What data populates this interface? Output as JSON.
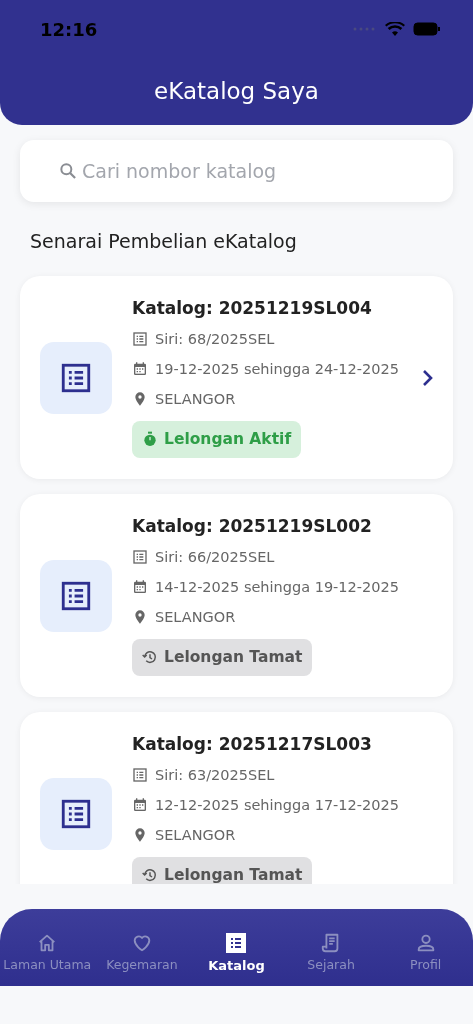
{
  "status_bar": {
    "time": "12:16"
  },
  "header": {
    "title": "eKatalog Saya"
  },
  "search": {
    "placeholder": "Cari nombor katalog"
  },
  "section_title": "Senarai Pembelian eKatalog",
  "catalogs": [
    {
      "title": "Katalog: 20251219SL004",
      "series": "Siri: 68/2025SEL",
      "dates": "19-12-2025 sehingga 24-12-2025",
      "location": "SELANGOR",
      "status": {
        "kind": "active",
        "label": "Lelongan Aktif"
      },
      "chevron": true
    },
    {
      "title": "Katalog: 20251219SL002",
      "series": "Siri: 66/2025SEL",
      "dates": "14-12-2025 sehingga 19-12-2025",
      "location": "SELANGOR",
      "status": {
        "kind": "ended",
        "label": "Lelongan Tamat"
      },
      "chevron": false
    },
    {
      "title": "Katalog: 20251217SL003",
      "series": "Siri: 63/2025SEL",
      "dates": "12-12-2025 sehingga 17-12-2025",
      "location": "SELANGOR",
      "status": {
        "kind": "ended",
        "label": "Lelongan Tamat"
      },
      "chevron": false
    }
  ],
  "nav": [
    {
      "label": "Laman Utama",
      "kind": "home",
      "selected": false
    },
    {
      "label": "Kegemaran",
      "kind": "favourites",
      "selected": false
    },
    {
      "label": "Katalog",
      "kind": "catalog",
      "selected": true
    },
    {
      "label": "Sejarah",
      "kind": "history",
      "selected": false
    },
    {
      "label": "Profil",
      "kind": "profile",
      "selected": false
    }
  ]
}
